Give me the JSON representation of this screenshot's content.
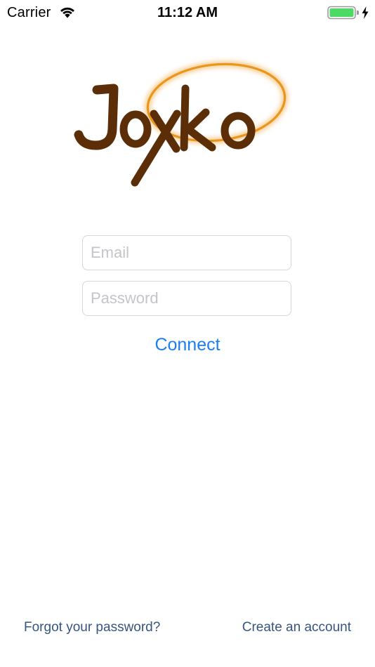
{
  "status_bar": {
    "carrier": "Carrier",
    "time": "11:12 AM",
    "wifi_icon": "wifi-icon",
    "battery_icon": "battery-icon",
    "charging_icon": "charging-bolt-icon",
    "battery_level": 1.0,
    "battery_color": "#4cd964"
  },
  "logo": {
    "text": "Joxko",
    "text_color": "#5c2e08",
    "ring_color": "#f2a73c"
  },
  "login_form": {
    "email_placeholder": "Email",
    "email_value": "",
    "password_placeholder": "Password",
    "password_value": "",
    "connect_label": "Connect",
    "accent_color": "#1a7ef5"
  },
  "footer": {
    "forgot_password_label": "Forgot your password?",
    "create_account_label": "Create an account",
    "link_color": "#36557f"
  }
}
